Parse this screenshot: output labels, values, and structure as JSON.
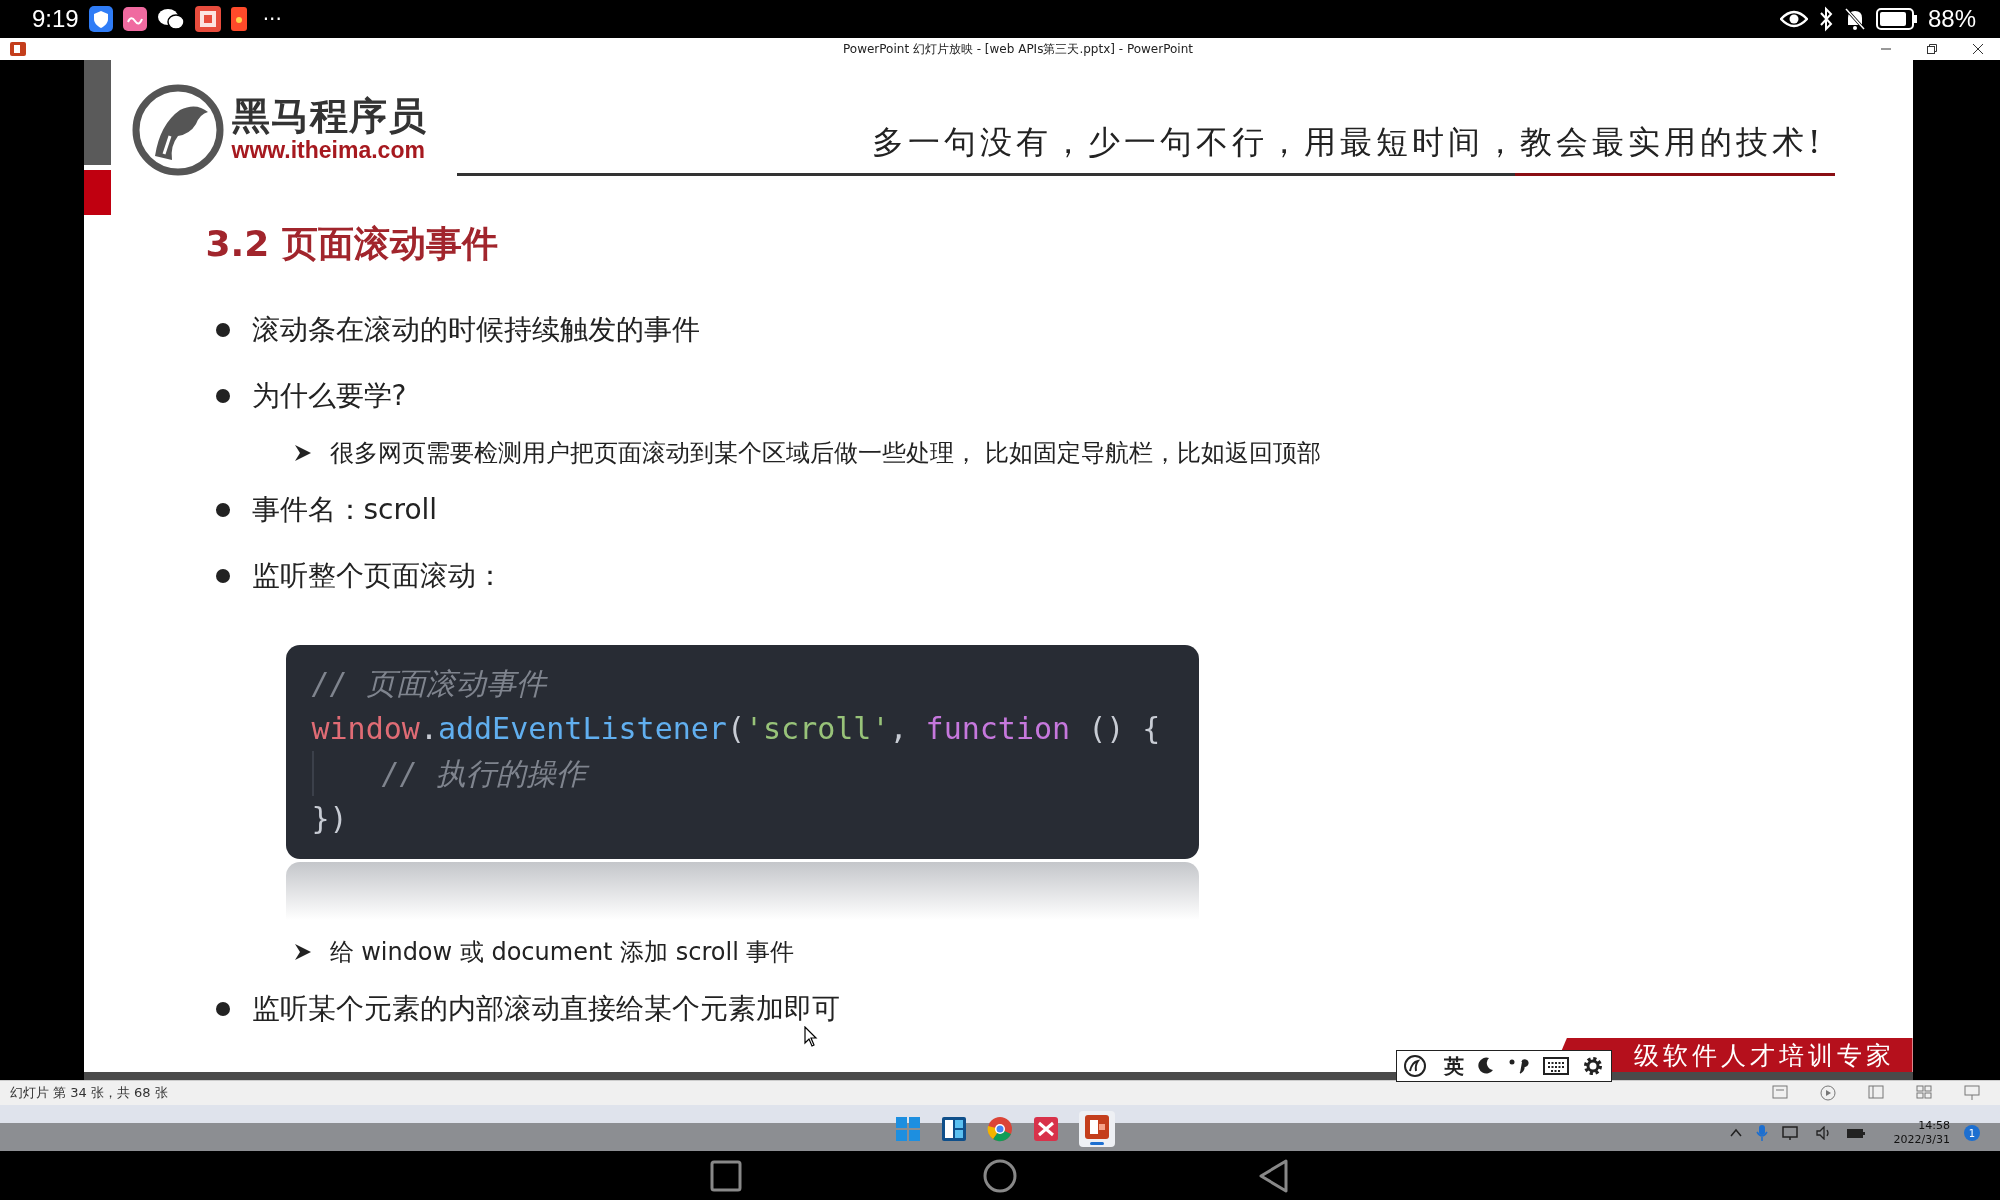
{
  "device_status_bar": {
    "time": "9:19",
    "more": "···",
    "battery": "88%"
  },
  "window": {
    "title": "PowerPoint 幻灯片放映 - [web APIs第三天.pptx] - PowerPoint"
  },
  "slide": {
    "logo": {
      "name": "黑马程序员",
      "url": "www.itheima.com"
    },
    "slogan": "多一句没有，少一句不行，用最短时间，教会最实用的技术!",
    "heading": "3.2 页面滚动事件",
    "items": [
      {
        "kind": "bullet",
        "text": "滚动条在滚动的时候持续触发的事件"
      },
      {
        "kind": "bullet",
        "text": "为什么要学?"
      },
      {
        "kind": "sub",
        "text": "很多网页需要检测用户把页面滚动到某个区域后做一些处理， 比如固定导航栏，比如返回顶部"
      },
      {
        "kind": "bullet",
        "text": "事件名：scroll"
      },
      {
        "kind": "bullet",
        "text": "监听整个页面滚动："
      },
      {
        "kind": "code",
        "lines": [
          {
            "indented": false,
            "tokens": [
              {
                "kind": "comment",
                "text": "// 页面滚动事件"
              }
            ]
          },
          {
            "indented": false,
            "tokens": [
              {
                "kind": "variable",
                "text": "window"
              },
              {
                "kind": "plain",
                "text": "."
              },
              {
                "kind": "method",
                "text": "addEventListener"
              },
              {
                "kind": "plain",
                "text": "("
              },
              {
                "kind": "string",
                "text": "'scroll'"
              },
              {
                "kind": "plain",
                "text": ", "
              },
              {
                "kind": "keyword",
                "text": "function"
              },
              {
                "kind": "plain",
                "text": " () {"
              }
            ]
          },
          {
            "indented": true,
            "tokens": [
              {
                "kind": "comment",
                "text": "// 执行的操作"
              }
            ]
          },
          {
            "indented": false,
            "tokens": [
              {
                "kind": "plain",
                "text": "})"
              }
            ]
          }
        ]
      },
      {
        "kind": "sub",
        "text": "给 window 或 document 添加 scroll 事件"
      },
      {
        "kind": "bullet",
        "text": "监听某个元素的内部滚动直接给某个元素加即可"
      }
    ],
    "banner": "级软件人才培训专家"
  },
  "ime_bar": {
    "language": "英"
  },
  "status_bar": {
    "slide_position": "幻灯片 第 34 张，共 68 张"
  },
  "taskbar": {
    "time": "14:58",
    "date": "2022/3/31",
    "notifications": "1"
  }
}
